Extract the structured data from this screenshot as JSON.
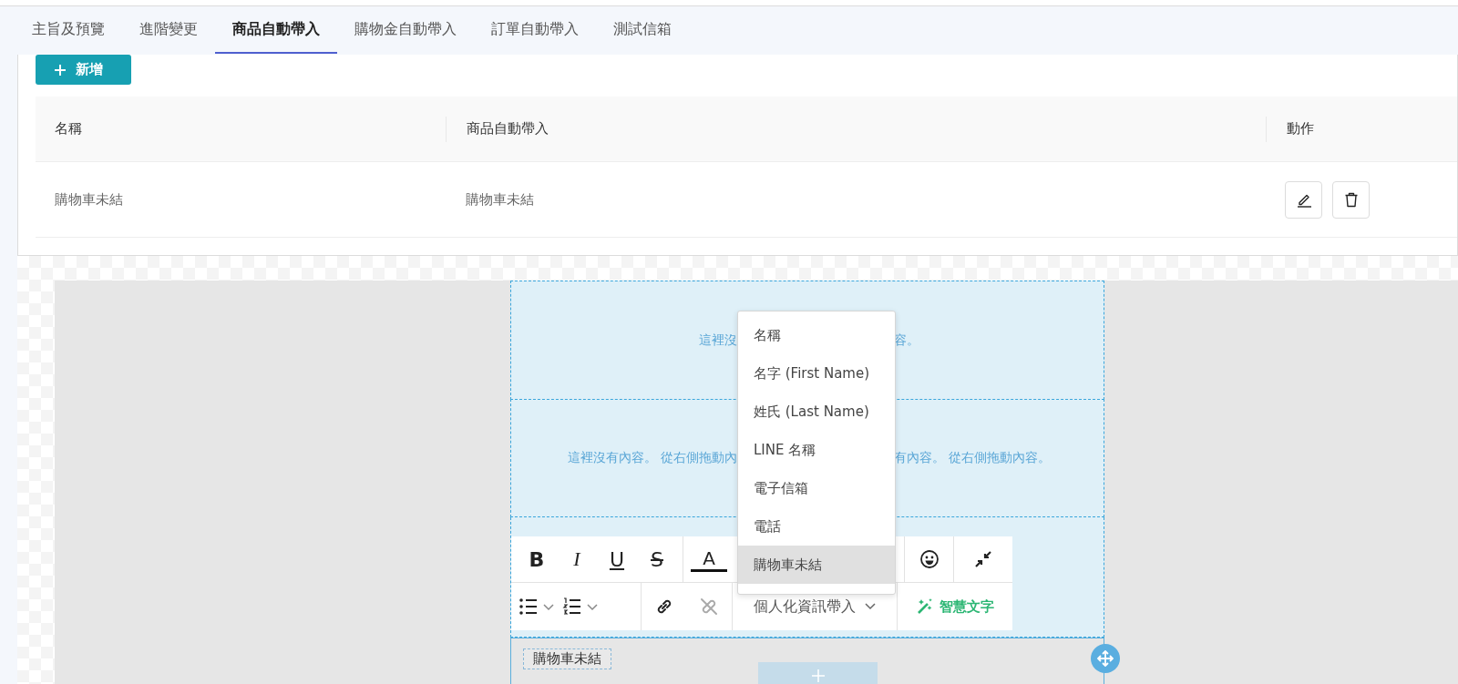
{
  "tabs": [
    {
      "label": "主旨及預覽",
      "selected": false
    },
    {
      "label": "進階變更",
      "selected": false
    },
    {
      "label": "商品自動帶入",
      "selected": true
    },
    {
      "label": "購物金自動帶入",
      "selected": false
    },
    {
      "label": "訂單自動帶入",
      "selected": false
    },
    {
      "label": "測試信箱",
      "selected": false
    }
  ],
  "add_button": {
    "label": "新增"
  },
  "table": {
    "columns": [
      "名稱",
      "商品自動帶入",
      "動作"
    ],
    "rows": [
      {
        "name": "購物車未結",
        "product_auto_fill": "購物車未結"
      }
    ]
  },
  "editor": {
    "blocks": [
      {
        "text_left": "這裡沒",
        "text_right": "容。"
      },
      {
        "text_left": "這裡沒有內容。 從右側拖動內",
        "text_right": "有內容。 從右側拖動內容。"
      }
    ],
    "toolbar": {
      "format_buttons": [
        {
          "glyph": "B",
          "kind": "bold"
        },
        {
          "glyph": "I",
          "kind": "italic"
        },
        {
          "glyph": "U",
          "kind": "underline"
        },
        {
          "glyph": "S",
          "kind": "strike"
        }
      ],
      "color_glyph": "A",
      "personalize": "個人化資訊帶入",
      "smart_text": "智慧文字"
    },
    "merge_tag": "購物車未結"
  },
  "dropdown": {
    "items": [
      {
        "label": "名稱",
        "selected": false
      },
      {
        "label": "名字 (First Name)",
        "selected": false
      },
      {
        "label": "姓氏 (Last Name)",
        "selected": false
      },
      {
        "label": "LINE 名稱",
        "selected": false
      },
      {
        "label": "電子信箱",
        "selected": false
      },
      {
        "label": "電話",
        "selected": false
      },
      {
        "label": "購物車未結",
        "selected": true
      }
    ]
  }
}
